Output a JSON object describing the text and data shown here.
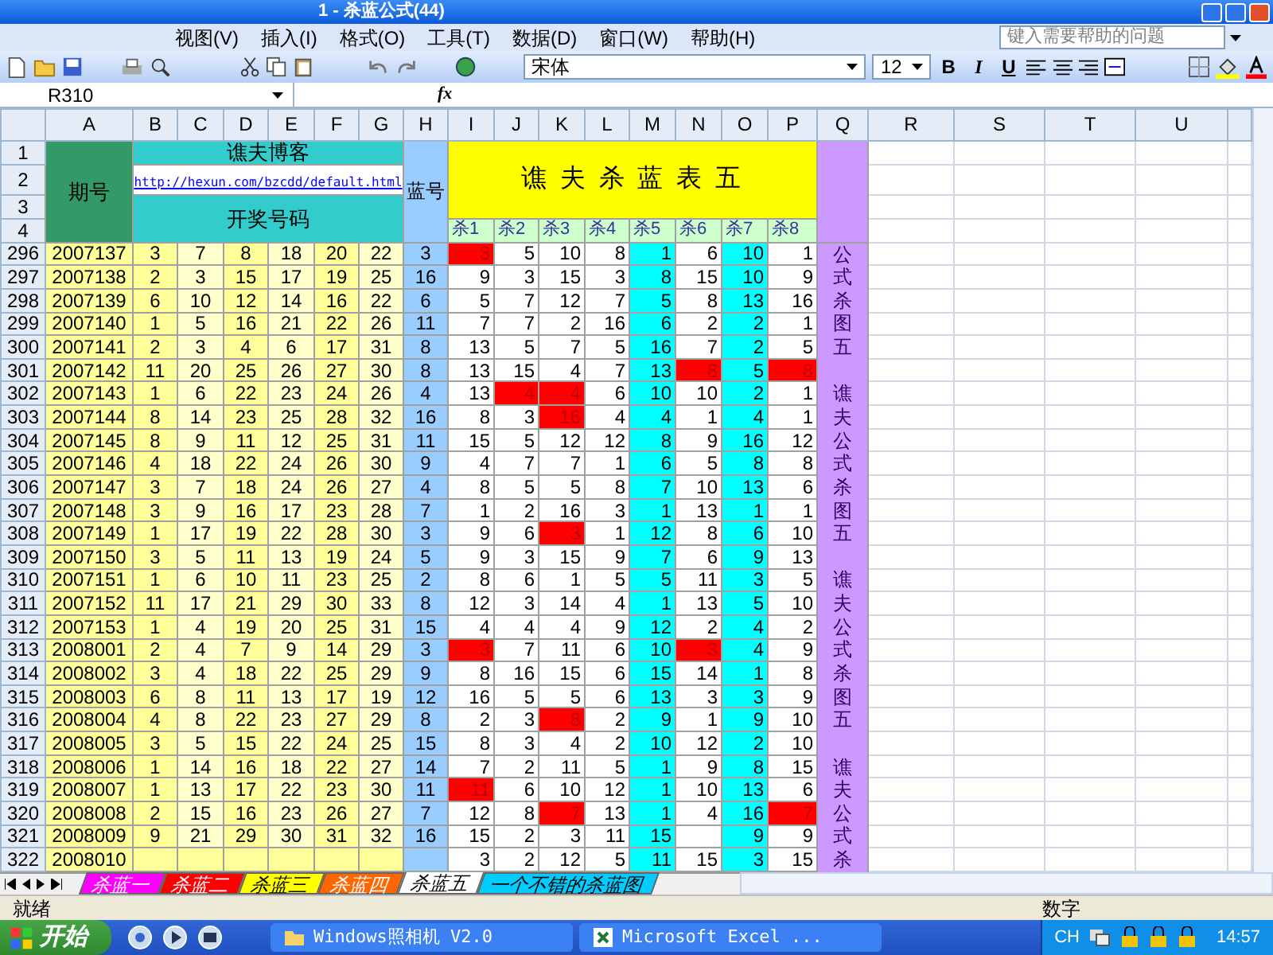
{
  "window": {
    "title": "1 - 杀蓝公式(44)"
  },
  "menu": [
    "视图(V)",
    "插入(I)",
    "格式(O)",
    "工具(T)",
    "数据(D)",
    "窗口(W)",
    "帮助(H)"
  ],
  "help_box": {
    "placeholder": "键入需要帮助的问题"
  },
  "format_bar": {
    "font": "宋体",
    "size": "12",
    "bold": "B",
    "italic": "I",
    "underline": "U"
  },
  "formula_bar": {
    "name_box": "R310",
    "fx": "fx"
  },
  "columns": [
    "A",
    "B",
    "C",
    "D",
    "E",
    "F",
    "G",
    "H",
    "I",
    "J",
    "K",
    "L",
    "M",
    "N",
    "O",
    "P",
    "Q",
    "R",
    "S",
    "T",
    "U"
  ],
  "header": {
    "issue_label": "期号",
    "blog_title": "谯夫博客",
    "blog_link": "http://hexun.com/bzcdd/default.html",
    "numbers_label": "开奖号码",
    "blue_label": "蓝号",
    "table_title": "谯 夫 杀 蓝 表 五",
    "kill_labels": [
      "杀1",
      "杀2",
      "杀3",
      "杀4",
      "杀5",
      "杀6",
      "杀7",
      "杀8"
    ],
    "header_rows": [
      "1",
      "2",
      "3",
      "4"
    ]
  },
  "rows": [
    {
      "row": "296",
      "issue": "2007137",
      "numbers": [
        "3",
        "7",
        "8",
        "18",
        "20",
        "22"
      ],
      "blue": "3",
      "kills": [
        {
          "value": "3",
          "hit": true
        },
        {
          "value": "5",
          "hit": false
        },
        {
          "value": "10",
          "hit": false
        },
        {
          "value": "8",
          "hit": false
        },
        {
          "value": "1",
          "hit": false
        },
        {
          "value": "6",
          "hit": false
        },
        {
          "value": "10",
          "hit": false
        },
        {
          "value": "1",
          "hit": false
        }
      ],
      "note": "公"
    },
    {
      "row": "297",
      "issue": "2007138",
      "numbers": [
        "2",
        "3",
        "15",
        "17",
        "19",
        "25"
      ],
      "blue": "16",
      "kills": [
        {
          "value": "9",
          "hit": false
        },
        {
          "value": "3",
          "hit": false
        },
        {
          "value": "15",
          "hit": false
        },
        {
          "value": "3",
          "hit": false
        },
        {
          "value": "8",
          "hit": false
        },
        {
          "value": "15",
          "hit": false
        },
        {
          "value": "10",
          "hit": false
        },
        {
          "value": "9",
          "hit": false
        }
      ],
      "note": "式"
    },
    {
      "row": "298",
      "issue": "2007139",
      "numbers": [
        "6",
        "10",
        "12",
        "14",
        "16",
        "22"
      ],
      "blue": "6",
      "kills": [
        {
          "value": "5",
          "hit": false
        },
        {
          "value": "7",
          "hit": false
        },
        {
          "value": "12",
          "hit": false
        },
        {
          "value": "7",
          "hit": false
        },
        {
          "value": "5",
          "hit": false
        },
        {
          "value": "8",
          "hit": false
        },
        {
          "value": "13",
          "hit": false
        },
        {
          "value": "16",
          "hit": false
        }
      ],
      "note": "杀"
    },
    {
      "row": "299",
      "issue": "2007140",
      "numbers": [
        "1",
        "5",
        "16",
        "21",
        "22",
        "26"
      ],
      "blue": "11",
      "kills": [
        {
          "value": "7",
          "hit": false
        },
        {
          "value": "7",
          "hit": false
        },
        {
          "value": "2",
          "hit": false
        },
        {
          "value": "16",
          "hit": false
        },
        {
          "value": "6",
          "hit": false
        },
        {
          "value": "2",
          "hit": false
        },
        {
          "value": "2",
          "hit": false
        },
        {
          "value": "1",
          "hit": false
        }
      ],
      "note": "图"
    },
    {
      "row": "300",
      "issue": "2007141",
      "numbers": [
        "2",
        "3",
        "4",
        "6",
        "17",
        "31"
      ],
      "blue": "8",
      "kills": [
        {
          "value": "13",
          "hit": false
        },
        {
          "value": "5",
          "hit": false
        },
        {
          "value": "7",
          "hit": false
        },
        {
          "value": "5",
          "hit": false
        },
        {
          "value": "16",
          "hit": false
        },
        {
          "value": "7",
          "hit": false
        },
        {
          "value": "2",
          "hit": false
        },
        {
          "value": "5",
          "hit": false
        }
      ],
      "note": "五"
    },
    {
      "row": "301",
      "issue": "2007142",
      "numbers": [
        "11",
        "20",
        "25",
        "26",
        "27",
        "30"
      ],
      "blue": "8",
      "kills": [
        {
          "value": "13",
          "hit": false
        },
        {
          "value": "15",
          "hit": false
        },
        {
          "value": "4",
          "hit": false
        },
        {
          "value": "7",
          "hit": false
        },
        {
          "value": "13",
          "hit": false
        },
        {
          "value": "8",
          "hit": true
        },
        {
          "value": "5",
          "hit": false
        },
        {
          "value": "8",
          "hit": true
        }
      ]
    },
    {
      "row": "302",
      "issue": "2007143",
      "numbers": [
        "1",
        "6",
        "22",
        "23",
        "24",
        "26"
      ],
      "blue": "4",
      "kills": [
        {
          "value": "13",
          "hit": false
        },
        {
          "value": "4",
          "hit": true
        },
        {
          "value": "4",
          "hit": true
        },
        {
          "value": "6",
          "hit": false
        },
        {
          "value": "10",
          "hit": false
        },
        {
          "value": "10",
          "hit": false
        },
        {
          "value": "2",
          "hit": false
        },
        {
          "value": "1",
          "hit": false
        }
      ],
      "note": "谯"
    },
    {
      "row": "303",
      "issue": "2007144",
      "numbers": [
        "8",
        "14",
        "23",
        "25",
        "28",
        "32"
      ],
      "blue": "16",
      "kills": [
        {
          "value": "8",
          "hit": false
        },
        {
          "value": "3",
          "hit": false
        },
        {
          "value": "16",
          "hit": true
        },
        {
          "value": "4",
          "hit": false
        },
        {
          "value": "4",
          "hit": false
        },
        {
          "value": "1",
          "hit": false
        },
        {
          "value": "4",
          "hit": false
        },
        {
          "value": "1",
          "hit": false
        }
      ],
      "note": "夫"
    },
    {
      "row": "304",
      "issue": "2007145",
      "numbers": [
        "8",
        "9",
        "11",
        "12",
        "25",
        "31"
      ],
      "blue": "11",
      "kills": [
        {
          "value": "15",
          "hit": false
        },
        {
          "value": "5",
          "hit": false
        },
        {
          "value": "12",
          "hit": false
        },
        {
          "value": "12",
          "hit": false
        },
        {
          "value": "8",
          "hit": false
        },
        {
          "value": "9",
          "hit": false
        },
        {
          "value": "16",
          "hit": false
        },
        {
          "value": "12",
          "hit": false
        }
      ],
      "note": "公"
    },
    {
      "row": "305",
      "issue": "2007146",
      "numbers": [
        "4",
        "18",
        "22",
        "24",
        "26",
        "30"
      ],
      "blue": "9",
      "kills": [
        {
          "value": "4",
          "hit": false
        },
        {
          "value": "7",
          "hit": false
        },
        {
          "value": "7",
          "hit": false
        },
        {
          "value": "1",
          "hit": false
        },
        {
          "value": "6",
          "hit": false
        },
        {
          "value": "5",
          "hit": false
        },
        {
          "value": "8",
          "hit": false
        },
        {
          "value": "8",
          "hit": false
        }
      ],
      "note": "式"
    },
    {
      "row": "306",
      "issue": "2007147",
      "numbers": [
        "3",
        "7",
        "18",
        "24",
        "26",
        "27"
      ],
      "blue": "4",
      "kills": [
        {
          "value": "8",
          "hit": false
        },
        {
          "value": "5",
          "hit": false
        },
        {
          "value": "5",
          "hit": false
        },
        {
          "value": "8",
          "hit": false
        },
        {
          "value": "7",
          "hit": false
        },
        {
          "value": "10",
          "hit": false
        },
        {
          "value": "13",
          "hit": false
        },
        {
          "value": "6",
          "hit": false
        }
      ],
      "note": "杀"
    },
    {
      "row": "307",
      "issue": "2007148",
      "numbers": [
        "3",
        "9",
        "16",
        "17",
        "23",
        "28"
      ],
      "blue": "7",
      "kills": [
        {
          "value": "1",
          "hit": false
        },
        {
          "value": "2",
          "hit": false
        },
        {
          "value": "16",
          "hit": false
        },
        {
          "value": "3",
          "hit": false
        },
        {
          "value": "1",
          "hit": false
        },
        {
          "value": "13",
          "hit": false
        },
        {
          "value": "1",
          "hit": false
        },
        {
          "value": "1",
          "hit": false
        }
      ],
      "note": "图"
    },
    {
      "row": "308",
      "issue": "2007149",
      "numbers": [
        "1",
        "17",
        "19",
        "22",
        "28",
        "30"
      ],
      "blue": "3",
      "kills": [
        {
          "value": "9",
          "hit": false
        },
        {
          "value": "6",
          "hit": false
        },
        {
          "value": "3",
          "hit": true
        },
        {
          "value": "1",
          "hit": false
        },
        {
          "value": "12",
          "hit": false
        },
        {
          "value": "8",
          "hit": false
        },
        {
          "value": "6",
          "hit": false
        },
        {
          "value": "10",
          "hit": false
        }
      ],
      "note": "五"
    },
    {
      "row": "309",
      "issue": "2007150",
      "numbers": [
        "3",
        "5",
        "11",
        "13",
        "19",
        "24"
      ],
      "blue": "5",
      "kills": [
        {
          "value": "9",
          "hit": false
        },
        {
          "value": "3",
          "hit": false
        },
        {
          "value": "15",
          "hit": false
        },
        {
          "value": "9",
          "hit": false
        },
        {
          "value": "7",
          "hit": false
        },
        {
          "value": "6",
          "hit": false
        },
        {
          "value": "9",
          "hit": false
        },
        {
          "value": "13",
          "hit": false
        }
      ]
    },
    {
      "row": "310",
      "issue": "2007151",
      "numbers": [
        "1",
        "6",
        "10",
        "11",
        "23",
        "25"
      ],
      "blue": "2",
      "kills": [
        {
          "value": "8",
          "hit": false
        },
        {
          "value": "6",
          "hit": false
        },
        {
          "value": "1",
          "hit": false
        },
        {
          "value": "5",
          "hit": false
        },
        {
          "value": "5",
          "hit": false
        },
        {
          "value": "11",
          "hit": false
        },
        {
          "value": "3",
          "hit": false
        },
        {
          "value": "5",
          "hit": false
        }
      ],
      "note": "谯"
    },
    {
      "row": "311",
      "issue": "2007152",
      "numbers": [
        "11",
        "17",
        "21",
        "29",
        "30",
        "33"
      ],
      "blue": "8",
      "kills": [
        {
          "value": "12",
          "hit": false
        },
        {
          "value": "3",
          "hit": false
        },
        {
          "value": "14",
          "hit": false
        },
        {
          "value": "4",
          "hit": false
        },
        {
          "value": "1",
          "hit": false
        },
        {
          "value": "13",
          "hit": false
        },
        {
          "value": "5",
          "hit": false
        },
        {
          "value": "10",
          "hit": false
        }
      ],
      "note": "夫"
    },
    {
      "row": "312",
      "issue": "2007153",
      "numbers": [
        "1",
        "4",
        "19",
        "20",
        "25",
        "31"
      ],
      "blue": "15",
      "kills": [
        {
          "value": "4",
          "hit": false
        },
        {
          "value": "4",
          "hit": false
        },
        {
          "value": "4",
          "hit": false
        },
        {
          "value": "9",
          "hit": false
        },
        {
          "value": "12",
          "hit": false
        },
        {
          "value": "2",
          "hit": false
        },
        {
          "value": "4",
          "hit": false
        },
        {
          "value": "2",
          "hit": false
        }
      ],
      "note": "公"
    },
    {
      "row": "313",
      "issue": "2008001",
      "numbers": [
        "2",
        "4",
        "7",
        "9",
        "14",
        "29"
      ],
      "blue": "3",
      "kills": [
        {
          "value": "3",
          "hit": true
        },
        {
          "value": "7",
          "hit": false
        },
        {
          "value": "11",
          "hit": false
        },
        {
          "value": "6",
          "hit": false
        },
        {
          "value": "10",
          "hit": false
        },
        {
          "value": "3",
          "hit": true
        },
        {
          "value": "4",
          "hit": false
        },
        {
          "value": "9",
          "hit": false
        }
      ],
      "note": "式"
    },
    {
      "row": "314",
      "issue": "2008002",
      "numbers": [
        "3",
        "4",
        "18",
        "22",
        "25",
        "29"
      ],
      "blue": "9",
      "kills": [
        {
          "value": "8",
          "hit": false
        },
        {
          "value": "16",
          "hit": false
        },
        {
          "value": "15",
          "hit": false
        },
        {
          "value": "6",
          "hit": false
        },
        {
          "value": "15",
          "hit": false
        },
        {
          "value": "14",
          "hit": false
        },
        {
          "value": "1",
          "hit": false
        },
        {
          "value": "8",
          "hit": false
        }
      ],
      "note": "杀"
    },
    {
      "row": "315",
      "issue": "2008003",
      "numbers": [
        "6",
        "8",
        "11",
        "13",
        "17",
        "19"
      ],
      "blue": "12",
      "kills": [
        {
          "value": "16",
          "hit": false
        },
        {
          "value": "5",
          "hit": false
        },
        {
          "value": "5",
          "hit": false
        },
        {
          "value": "6",
          "hit": false
        },
        {
          "value": "13",
          "hit": false
        },
        {
          "value": "3",
          "hit": false
        },
        {
          "value": "3",
          "hit": false
        },
        {
          "value": "9",
          "hit": false
        }
      ],
      "note": "图"
    },
    {
      "row": "316",
      "issue": "2008004",
      "numbers": [
        "4",
        "8",
        "22",
        "23",
        "27",
        "29"
      ],
      "blue": "8",
      "kills": [
        {
          "value": "2",
          "hit": false
        },
        {
          "value": "3",
          "hit": false
        },
        {
          "value": "8",
          "hit": true
        },
        {
          "value": "2",
          "hit": false
        },
        {
          "value": "9",
          "hit": false
        },
        {
          "value": "1",
          "hit": false
        },
        {
          "value": "9",
          "hit": false
        },
        {
          "value": "10",
          "hit": false
        }
      ],
      "note": "五"
    },
    {
      "row": "317",
      "issue": "2008005",
      "numbers": [
        "3",
        "5",
        "15",
        "22",
        "24",
        "25"
      ],
      "blue": "15",
      "kills": [
        {
          "value": "8",
          "hit": false
        },
        {
          "value": "3",
          "hit": false
        },
        {
          "value": "4",
          "hit": false
        },
        {
          "value": "2",
          "hit": false
        },
        {
          "value": "10",
          "hit": false
        },
        {
          "value": "12",
          "hit": false
        },
        {
          "value": "2",
          "hit": false
        },
        {
          "value": "10",
          "hit": false
        }
      ]
    },
    {
      "row": "318",
      "issue": "2008006",
      "numbers": [
        "1",
        "14",
        "16",
        "18",
        "22",
        "27"
      ],
      "blue": "14",
      "kills": [
        {
          "value": "7",
          "hit": false
        },
        {
          "value": "2",
          "hit": false
        },
        {
          "value": "11",
          "hit": false
        },
        {
          "value": "5",
          "hit": false
        },
        {
          "value": "1",
          "hit": false
        },
        {
          "value": "9",
          "hit": false
        },
        {
          "value": "8",
          "hit": false
        },
        {
          "value": "15",
          "hit": false
        }
      ],
      "note": "谯"
    },
    {
      "row": "319",
      "issue": "2008007",
      "numbers": [
        "1",
        "13",
        "17",
        "22",
        "23",
        "30"
      ],
      "blue": "11",
      "kills": [
        {
          "value": "11",
          "hit": true
        },
        {
          "value": "6",
          "hit": false
        },
        {
          "value": "10",
          "hit": false
        },
        {
          "value": "12",
          "hit": false
        },
        {
          "value": "1",
          "hit": false
        },
        {
          "value": "10",
          "hit": false
        },
        {
          "value": "13",
          "hit": false
        },
        {
          "value": "6",
          "hit": false
        }
      ],
      "note": "夫"
    },
    {
      "row": "320",
      "issue": "2008008",
      "numbers": [
        "2",
        "15",
        "16",
        "23",
        "26",
        "27"
      ],
      "blue": "7",
      "kills": [
        {
          "value": "12",
          "hit": false
        },
        {
          "value": "8",
          "hit": false
        },
        {
          "value": "7",
          "hit": true
        },
        {
          "value": "13",
          "hit": false
        },
        {
          "value": "1",
          "hit": false
        },
        {
          "value": "4",
          "hit": false
        },
        {
          "value": "16",
          "hit": false
        },
        {
          "value": "7",
          "hit": true
        }
      ],
      "note": "公"
    },
    {
      "row": "321",
      "issue": "2008009",
      "numbers": [
        "9",
        "21",
        "29",
        "30",
        "31",
        "32"
      ],
      "blue": "16",
      "kills": [
        {
          "value": "15",
          "hit": false
        },
        {
          "value": "2",
          "hit": false
        },
        {
          "value": "3",
          "hit": false
        },
        {
          "value": "11",
          "hit": false
        },
        {
          "value": "15",
          "hit": false
        },
        {
          "hit": false
        },
        {
          "value": "9",
          "hit": false
        },
        {
          "value": "9",
          "hit": false
        }
      ],
      "note": "式"
    },
    {
      "row": "322",
      "issue": "2008010",
      "numbers": [],
      "kills": [
        {
          "value": "3",
          "hit": false
        },
        {
          "value": "2",
          "hit": false
        },
        {
          "value": "12",
          "hit": false
        },
        {
          "value": "5",
          "hit": false
        },
        {
          "value": "11",
          "hit": false
        },
        {
          "value": "15",
          "hit": false
        },
        {
          "value": "3",
          "hit": false
        },
        {
          "value": "15",
          "hit": false
        }
      ],
      "note": "杀"
    }
  ],
  "sheet_tabs": [
    {
      "label": "杀蓝一",
      "color": "#ff00ff",
      "selected": false
    },
    {
      "label": "杀蓝二",
      "color": "#ff0000",
      "selected": false
    },
    {
      "label": "杀蓝三",
      "color": "#ffff00",
      "selected": false
    },
    {
      "label": "杀蓝四",
      "color": "#ff6600",
      "selected": false
    },
    {
      "label": "杀蓝五",
      "color": "#ffffff",
      "selected": true
    },
    {
      "label": "一个不错的杀蓝图",
      "color": "#00ccff",
      "selected": false
    }
  ],
  "status_bar": {
    "left": "就绪",
    "right": "数字"
  },
  "taskbar": {
    "start": "开始",
    "tasks": [
      {
        "label": "Windows照相机 V2.0",
        "kind": "folder"
      },
      {
        "label": "Microsoft Excel ...",
        "kind": "excel"
      }
    ],
    "language": "CH",
    "clock": "14:57"
  }
}
